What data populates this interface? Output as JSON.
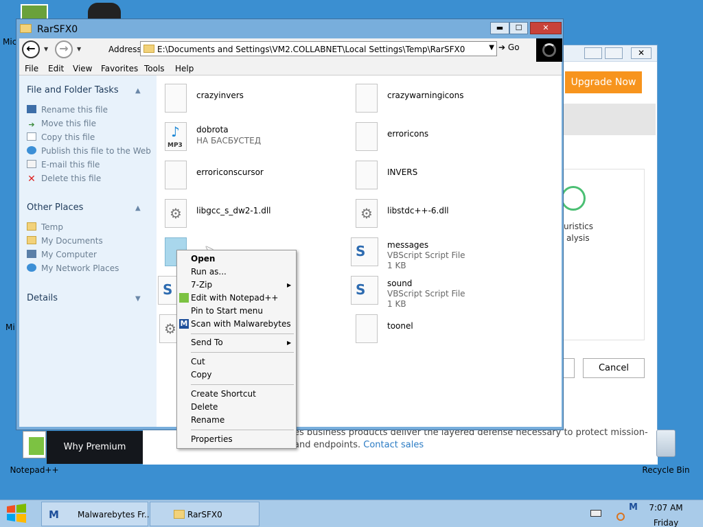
{
  "desktop": {
    "icons": [
      {
        "label": "Notepad++"
      },
      {
        "label": "Recycle Bin"
      }
    ],
    "edge_fragments": [
      "Mic",
      "Mi"
    ]
  },
  "malwarebytes_bg": {
    "upgrade_label": "Upgrade Now",
    "heuristics_line1": "uristics",
    "heuristics_line2": "alysis",
    "cancel_label": "Cancel",
    "why_premium_label": "Why Premium",
    "body_line1": "es business products deliver the layered defense necessary to protect mission-",
    "body_line2": "and endpoints.",
    "contact_link": "Contact sales"
  },
  "explorer": {
    "title": "RarSFX0",
    "controls": {
      "minimize": "▬",
      "maximize": "☐",
      "close": "✕"
    },
    "address_label": "Address",
    "address_value": "E:\\Documents and Settings\\VM2.COLLABNET\\Local Settings\\Temp\\RarSFX0",
    "go_label": "Go",
    "menu": [
      "File",
      "Edit",
      "View",
      "Favorites",
      "Tools",
      "Help"
    ],
    "tasks_section": {
      "title": "File and Folder Tasks",
      "items": [
        "Rename this file",
        "Move this file",
        "Copy this file",
        "Publish this file to the Web",
        "E-mail this file",
        "Delete this file"
      ]
    },
    "places_section": {
      "title": "Other Places",
      "items": [
        "Temp",
        "My Documents",
        "My Computer",
        "My Network Places"
      ]
    },
    "details_section": {
      "title": "Details"
    },
    "files": [
      {
        "name": "crazyinvers"
      },
      {
        "name": "crazywarningicons"
      },
      {
        "name": "dobrota",
        "sub": "НА БАСБУСТЕД"
      },
      {
        "name": "erroricons"
      },
      {
        "name": "erroriconscursor"
      },
      {
        "name": "INVERS"
      },
      {
        "name": "libgcc_s_dw2-1.dll"
      },
      {
        "name": "libstdc++-6.dll"
      },
      {
        "name": "messages",
        "type": "VBScript Script File",
        "size": "1 KB"
      },
      {
        "name": "sound",
        "type": "VBScript Script File",
        "size": "1 KB"
      },
      {
        "name": "toonel"
      }
    ],
    "mp3_badge": "MP3"
  },
  "context_menu": {
    "items": [
      {
        "label": "Open"
      },
      {
        "label": "Run as..."
      },
      {
        "label": "7-Zip"
      },
      {
        "label": "Edit with Notepad++"
      },
      {
        "label": "Pin to Start menu"
      },
      {
        "label": "Scan with Malwarebytes"
      },
      {
        "label": "Send To"
      },
      {
        "label": "Cut"
      },
      {
        "label": "Copy"
      },
      {
        "label": "Create Shortcut"
      },
      {
        "label": "Delete"
      },
      {
        "label": "Rename"
      },
      {
        "label": "Properties"
      }
    ]
  },
  "taskbar": {
    "buttons": [
      {
        "label": "Malwarebytes Fr..."
      },
      {
        "label": "RarSFX0"
      }
    ],
    "time": "7:07 AM",
    "day": "Friday"
  },
  "colors": {
    "desktop": "#3b8fd1",
    "explorer_frame": "#78aedc",
    "upgrade": "#f7941d",
    "close": "#c8423a"
  }
}
